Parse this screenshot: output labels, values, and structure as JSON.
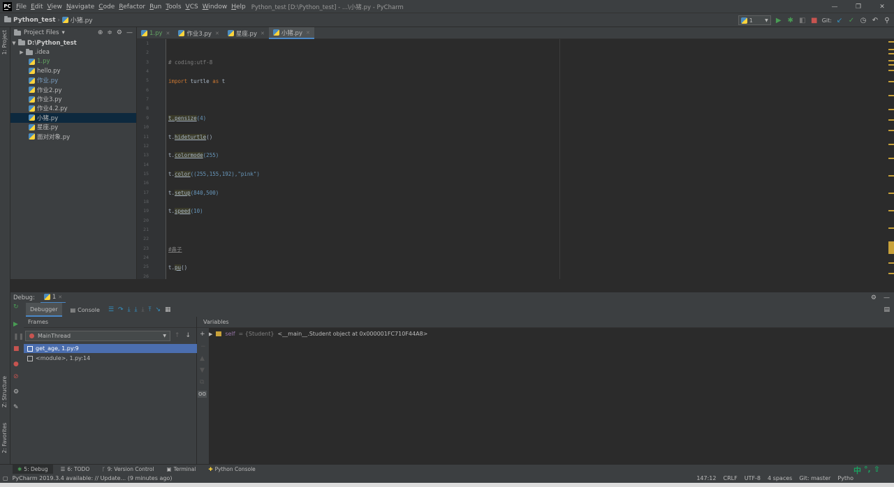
{
  "menubar": {
    "logo": "PC",
    "items": [
      "File",
      "Edit",
      "View",
      "Navigate",
      "Code",
      "Refactor",
      "Run",
      "Tools",
      "VCS",
      "Window",
      "Help"
    ],
    "title": "Python_test [D:\\Python_test] - ...\\小猪.py - PyCharm",
    "controls": [
      "—",
      "❐",
      "✕"
    ]
  },
  "navbar": {
    "project": "Python_test",
    "file": "小猪.py",
    "run_config": "1",
    "git_label": "Git:"
  },
  "left_strip": {
    "project_tab": "1: Project",
    "structure_tab": "Z: Structure",
    "favorites_tab": "2: Favorites"
  },
  "project": {
    "header": "Project Files",
    "root": "D:\\Python_test",
    "items": [
      {
        "name": ".idea",
        "kind": "folder"
      },
      {
        "name": "1.py",
        "kind": "file",
        "style": "green"
      },
      {
        "name": "hello.py",
        "kind": "file",
        "style": "normal"
      },
      {
        "name": "作业.py",
        "kind": "file",
        "style": "modified"
      },
      {
        "name": "作业2.py",
        "kind": "file",
        "style": "normal"
      },
      {
        "name": "作业3.py",
        "kind": "file",
        "style": "normal"
      },
      {
        "name": "作业4.2.py",
        "kind": "file",
        "style": "normal"
      },
      {
        "name": "小猪.py",
        "kind": "file",
        "style": "selected"
      },
      {
        "name": "星座.py",
        "kind": "file",
        "style": "normal"
      },
      {
        "name": "面对对象.py",
        "kind": "file",
        "style": "normal"
      }
    ]
  },
  "editor": {
    "tabs": [
      {
        "label": "1.py",
        "active": false,
        "style": "green"
      },
      {
        "label": "作业3.py",
        "active": false,
        "style": "normal"
      },
      {
        "label": "星座.py",
        "active": false,
        "style": "normal"
      },
      {
        "label": "小猪.py",
        "active": true,
        "style": "normal"
      }
    ],
    "line_numbers": [
      "1",
      "2",
      "3",
      "4",
      "5",
      "6",
      "7",
      "8",
      "9",
      "10",
      "11",
      "12",
      "13",
      "14",
      "15",
      "16",
      "17",
      "18",
      "19",
      "20",
      "21",
      "22",
      "23",
      "24",
      "25",
      "26"
    ],
    "code": {
      "l3": "# coding:utf-8",
      "l5_kw": "import",
      "l5_mod": " turtle ",
      "l5_as": "as",
      "l5_alias": " t",
      "l9_obj": "t.",
      "l9_fn": "pensize",
      "l9_args": "(4)",
      "l11_fn": "hideturtle",
      "l11_args": "()",
      "l13_fn": "colormode",
      "l13_args": "(255)",
      "l15_fn": "color",
      "l15_args": "((255,155,192),\"pink\")",
      "l17_fn": "setup",
      "l17_args": "(840,500)",
      "l19_fn": "speed",
      "l19_args": "(10)",
      "l23": "#鼻子",
      "l25_fn": "pu",
      "l25_args": "()"
    }
  },
  "debug": {
    "label": "Debug:",
    "session": "1",
    "tabs": [
      "Debugger",
      "Console"
    ],
    "frames_header": "Frames",
    "thread": "MainThread",
    "frames": [
      "get_age, 1.py:9",
      "<module>, 1.py:14"
    ],
    "variables_header": "Variables",
    "var_name": "self",
    "var_type": "= {Student}",
    "var_value": "<__main__.Student object at 0x000001FC710F44A8>"
  },
  "bottom_tabs": [
    "5: Debug",
    "6: TODO",
    "9: Version Control",
    "Terminal",
    "Python Console"
  ],
  "status": {
    "message": "PyCharm 2019.3.4 available: // Update... (9 minutes ago)",
    "position": "147:12",
    "line_sep": "CRLF",
    "encoding": "UTF-8",
    "indent": "4 spaces",
    "git": "Git: master",
    "interpreter": "Pytho"
  },
  "ime": {
    "lang": "中",
    "punct": "°,",
    "shift": "⇧"
  },
  "colors": {
    "accent": "#4a88c7",
    "selection": "#4b6eaf",
    "keyword": "#cc7832",
    "number": "#6897bb",
    "string": "#6a8759"
  }
}
